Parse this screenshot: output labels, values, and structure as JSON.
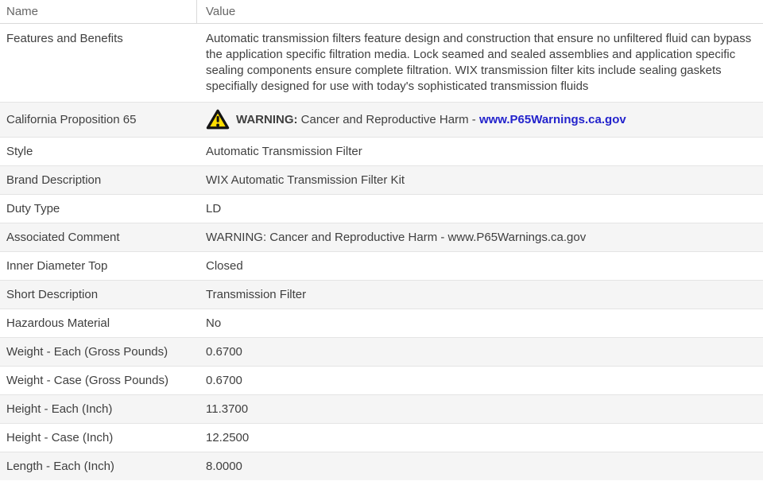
{
  "table": {
    "headers": {
      "name": "Name",
      "value": "Value"
    },
    "rows": [
      {
        "name": "Features and Benefits",
        "value": "Automatic transmission filters feature design and construction that ensure no unfiltered fluid can bypass the application specific filtration media. Lock seamed and sealed assemblies and application specific sealing components ensure complete filtration. WIX transmission filter kits include sealing gaskets specifially designed for use with today's sophisticated transmission fluids"
      },
      {
        "name": "California Proposition 65",
        "value_parts": {
          "icon": "warning-triangle-icon",
          "warning_label": "WARNING:",
          "text": " Cancer and Reproductive Harm - ",
          "link": "www.P65Warnings.ca.gov"
        }
      },
      {
        "name": "Style",
        "value": "Automatic Transmission Filter"
      },
      {
        "name": "Brand Description",
        "value": "WIX Automatic Transmission Filter Kit"
      },
      {
        "name": "Duty Type",
        "value": "LD"
      },
      {
        "name": "Associated Comment",
        "value": "WARNING: Cancer and Reproductive Harm - www.P65Warnings.ca.gov"
      },
      {
        "name": "Inner Diameter Top",
        "value": "Closed"
      },
      {
        "name": "Short Description",
        "value": "Transmission Filter"
      },
      {
        "name": "Hazardous Material",
        "value": "No"
      },
      {
        "name": "Weight - Each (Gross Pounds)",
        "value": "0.6700"
      },
      {
        "name": "Weight - Case (Gross Pounds)",
        "value": "0.6700"
      },
      {
        "name": "Height - Each (Inch)",
        "value": "11.3700"
      },
      {
        "name": "Height - Case (Inch)",
        "value": "12.2500"
      },
      {
        "name": "Length - Each (Inch)",
        "value": "8.0000"
      }
    ]
  },
  "colors": {
    "link_blue": "#2323cc",
    "warning_yellow": "#ffdd00",
    "stripe_gray": "#f5f5f5",
    "row_border": "#e4e4e4",
    "header_text": "#666666",
    "body_text": "#3f3f3f"
  }
}
